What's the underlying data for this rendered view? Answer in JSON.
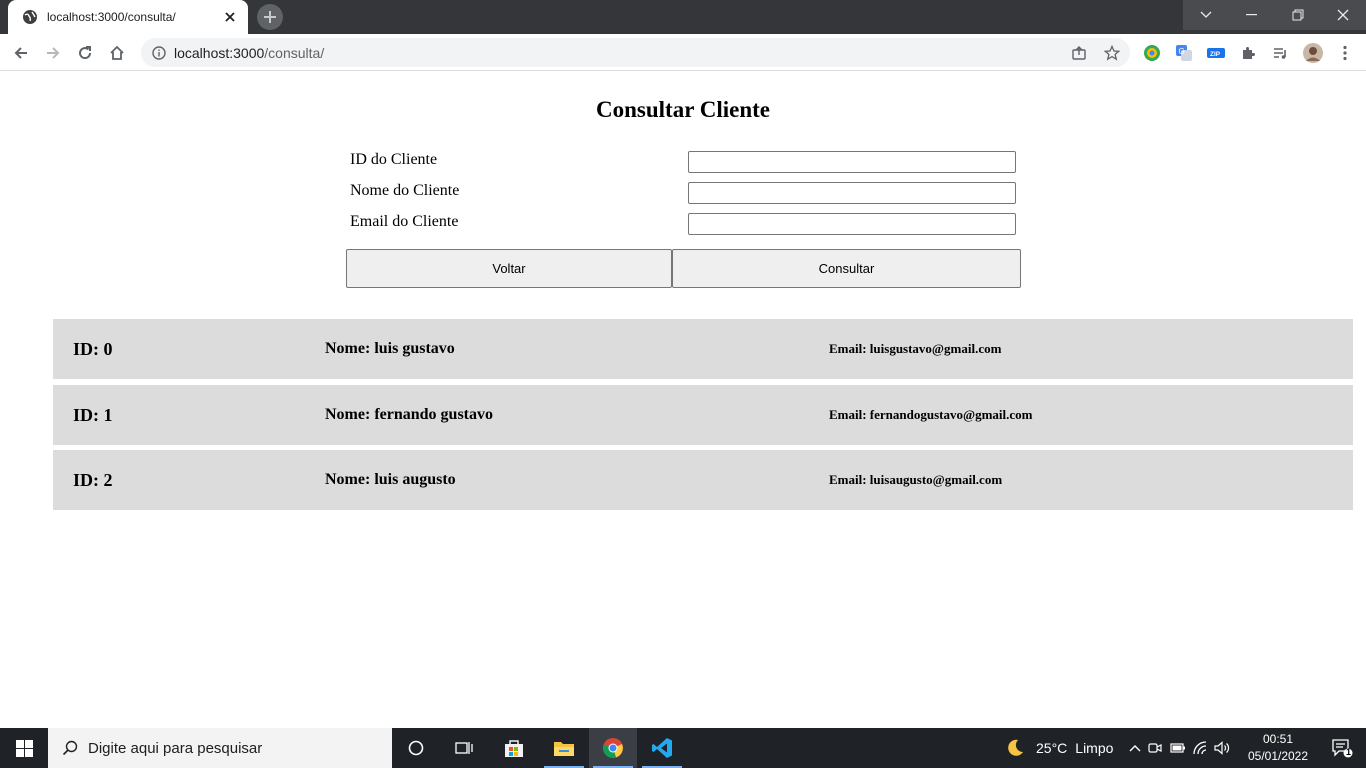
{
  "browser": {
    "tab_title": "localhost:3000/consulta/",
    "url_host": "localhost:3000",
    "url_path": "/consulta/"
  },
  "page": {
    "title": "Consultar Cliente",
    "form": {
      "id_label": "ID do Cliente",
      "id_value": "",
      "name_label": "Nome do Cliente",
      "name_value": "",
      "email_label": "Email do Cliente",
      "email_value": "",
      "back_button": "Voltar",
      "search_button": "Consultar"
    },
    "results": [
      {
        "id": "ID: 0",
        "name": "Nome: luis gustavo",
        "email": "Email: luisgustavo@gmail.com"
      },
      {
        "id": "ID: 1",
        "name": "Nome: fernando gustavo",
        "email": "Email: fernandogustavo@gmail.com"
      },
      {
        "id": "ID: 2",
        "name": "Nome: luis augusto",
        "email": "Email: luisaugusto@gmail.com"
      }
    ],
    "colors": {
      "card_bg": "#dcdcdc",
      "button_bg": "#efefef"
    }
  },
  "taskbar": {
    "search_placeholder": "Digite aqui para pesquisar",
    "weather_temp": "25°C",
    "weather_text": "Limpo",
    "time": "00:51",
    "date": "05/01/2022",
    "notification_count": "1"
  }
}
